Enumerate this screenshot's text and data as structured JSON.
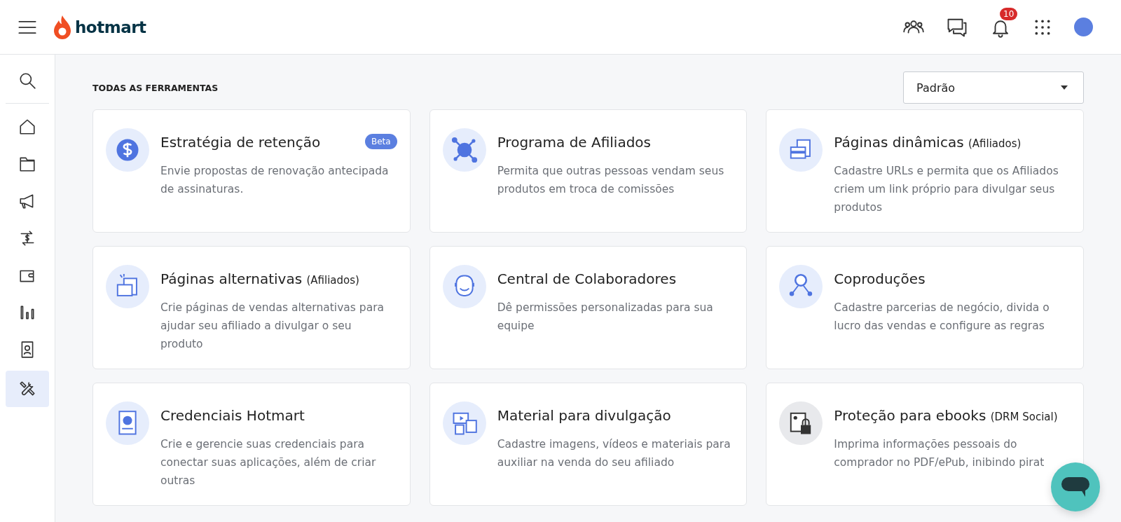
{
  "header": {
    "logo": "hotmart",
    "notifications": "10"
  },
  "sidebar": {
    "items": [
      {
        "selected": false
      },
      {
        "selected": false
      },
      {
        "selected": false
      },
      {
        "selected": false
      },
      {
        "selected": false
      },
      {
        "selected": false
      },
      {
        "selected": false
      },
      {
        "selected": false
      },
      {
        "selected": true
      }
    ]
  },
  "page": {
    "title": "TODAS AS FERRAMENTAS",
    "sort": {
      "value": "Padrão"
    }
  },
  "cards": [
    {
      "title": "Estratégia de retenção",
      "badge": "Beta",
      "description": "Envie propostas de renovação antecipada de assinaturas."
    },
    {
      "title": "Programa de Afiliados",
      "description": "Permita que outras pessoas vendam seus produtos em troca de comissões"
    },
    {
      "title": "Páginas dinâmicas",
      "note": "(Afiliados)",
      "description": "Cadastre URLs e permita que os Afiliados criem um link próprio para divulgar seus produtos"
    },
    {
      "title": "Páginas alternativas",
      "note": "(Afiliados)",
      "description": "Crie páginas de vendas alternativas para ajudar seu afiliado a divulgar o seu produto"
    },
    {
      "title": "Central de Colaboradores",
      "description": "Dê permissões personalizadas para sua equipe"
    },
    {
      "title": "Coproduções",
      "description": "Cadastre parcerias de negócio, divida o lucro das vendas e configure as regras"
    },
    {
      "title": "Credenciais Hotmart",
      "description": "Crie e gerencie suas credenciais para conectar suas aplicações, além de criar outras"
    },
    {
      "title": "Material para divulgação",
      "description": "Cadastre imagens, vídeos e materiais para auxiliar na venda do seu afiliado"
    },
    {
      "title": "Proteção para ebooks",
      "note": "(DRM Social)",
      "description": "Imprima informações pessoais do comprador no PDF/ePub, inibindo pirat"
    }
  ]
}
